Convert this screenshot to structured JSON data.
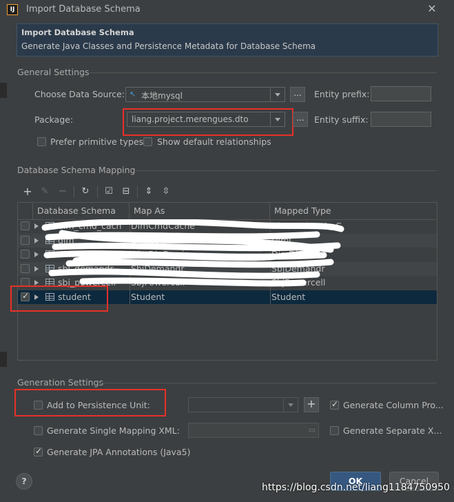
{
  "window": {
    "title": "Import Database Schema",
    "close_glyph": "✕",
    "app_icon_letter": "IJ"
  },
  "header": {
    "title": "Import Database Schema",
    "subtitle": "Generate Java Classes and Persistence Metadata for Database Schema"
  },
  "general": {
    "section_title": "General Settings",
    "datasource_label": "Choose Data Source:",
    "datasource_value": "本地mysql",
    "package_label": "Package:",
    "package_value": "liang.project.merengues.dto",
    "browse_label": "...",
    "entity_prefix_label": "Entity prefix:",
    "entity_prefix_value": "",
    "entity_suffix_label": "Entity suffix:",
    "entity_suffix_value": "",
    "prefer_primitive_label": "Prefer primitive types",
    "show_default_label": "Show default relationships"
  },
  "mapping": {
    "section_title": "Database Schema Mapping",
    "toolbar": [
      "add-icon",
      "edit-icon",
      "remove-icon",
      "refresh-icon",
      "check-all-icon",
      "uncheck-all-icon",
      "expand-all-icon",
      "collapse-all-icon"
    ],
    "columns": [
      "Database Schema",
      "Map As",
      "Mapped Type"
    ],
    "rows": [
      {
        "schema": "dim_cmd_cach",
        "map_as": "DimCmdCache",
        "mapped_type": "DimCmdCacheC",
        "checked": false
      },
      {
        "schema": "dim_",
        "map_as": "DimCount",
        "mapped_type": "DimC",
        "checked": false
      },
      {
        "schema": "dim_",
        "map_as": "DimDicCmain",
        "mapped_type": "DimDicmain",
        "checked": false
      },
      {
        "schema": "sbj_demandr",
        "map_as": "SbjDemandr",
        "mapped_type": "SbjDemandr",
        "checked": false
      },
      {
        "schema": "sbj_powercell",
        "map_as": "SbjPowercell",
        "mapped_type": "SbjPowercell",
        "checked": false
      },
      {
        "schema": "student",
        "map_as": "Student",
        "mapped_type": "Student",
        "checked": true
      }
    ]
  },
  "generation": {
    "section_title": "Generation Settings",
    "add_persistence_label": "Add to Persistence Unit:",
    "add_persistence_plus": "+",
    "gen_column_label": "Generate Column Pro...",
    "gen_single_xml_label": "Generate Single Mapping XML:",
    "gen_separate_label": "Generate Separate X...",
    "gen_jpa_label": "Generate JPA Annotations (Java5)"
  },
  "footer": {
    "help_label": "?",
    "ok_label": "OK",
    "cancel_label": "Cancel",
    "watermark": "https://blog.csdn.net/liang1184750950"
  },
  "colors": {
    "accent_red": "#e8302a",
    "selection": "#0d293e",
    "ok_button": "#365880"
  }
}
